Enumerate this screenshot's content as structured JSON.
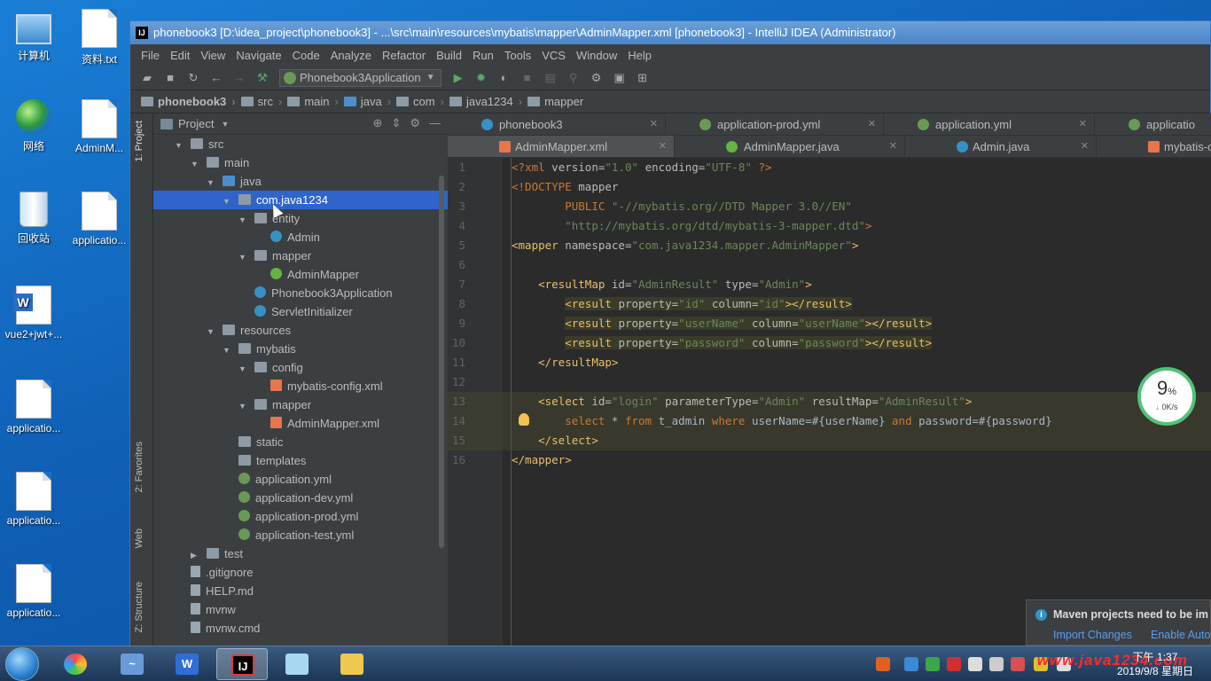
{
  "desktop": {
    "icons": [
      {
        "label": "计算机"
      },
      {
        "label": "资料.txt"
      },
      {
        "label": "网络"
      },
      {
        "label": "AdminM..."
      },
      {
        "label": "回收站"
      },
      {
        "label": "applicatio..."
      },
      {
        "label": "vue2+jwt+..."
      },
      {
        "label": "applicatio..."
      },
      {
        "label": "applicatio..."
      },
      {
        "label": "applicatio..."
      }
    ]
  },
  "window": {
    "title": "phonebook3 [D:\\idea_project\\phonebook3] - ...\\src\\main\\resources\\mybatis\\mapper\\AdminMapper.xml [phonebook3] - IntelliJ IDEA (Administrator)",
    "logo": "IJ"
  },
  "menu": [
    "File",
    "Edit",
    "View",
    "Navigate",
    "Code",
    "Analyze",
    "Refactor",
    "Build",
    "Run",
    "Tools",
    "VCS",
    "Window",
    "Help"
  ],
  "toolbar": {
    "run_config": "Phonebook3Application"
  },
  "breadcrumb": [
    "phonebook3",
    "src",
    "main",
    "java",
    "com",
    "java1234",
    "mapper"
  ],
  "sidebar": {
    "project_label": "1: Project",
    "favorites_label": "2: Favorites",
    "web_label": "Web",
    "structure_label": "Z: Structure"
  },
  "project_panel": {
    "title": "Project",
    "tree": [
      {
        "label": "src",
        "depth": 1,
        "caret": "▼",
        "icon": "folder"
      },
      {
        "label": "main",
        "depth": 2,
        "caret": "▼",
        "icon": "folder"
      },
      {
        "label": "java",
        "depth": 3,
        "caret": "▼",
        "icon": "folder-blue"
      },
      {
        "label": "com.java1234",
        "depth": 4,
        "caret": "▼",
        "icon": "folder",
        "selected": true
      },
      {
        "label": "entity",
        "depth": 5,
        "caret": "▼",
        "icon": "folder"
      },
      {
        "label": "Admin",
        "depth": 6,
        "caret": "",
        "icon": "class"
      },
      {
        "label": "mapper",
        "depth": 5,
        "caret": "▼",
        "icon": "folder"
      },
      {
        "label": "AdminMapper",
        "depth": 6,
        "caret": "",
        "icon": "iface"
      },
      {
        "label": "Phonebook3Application",
        "depth": 5,
        "caret": "",
        "icon": "class"
      },
      {
        "label": "ServletInitializer",
        "depth": 5,
        "caret": "",
        "icon": "class"
      },
      {
        "label": "resources",
        "depth": 3,
        "caret": "▼",
        "icon": "folder"
      },
      {
        "label": "mybatis",
        "depth": 4,
        "caret": "▼",
        "icon": "folder"
      },
      {
        "label": "config",
        "depth": 5,
        "caret": "▼",
        "icon": "folder"
      },
      {
        "label": "mybatis-config.xml",
        "depth": 6,
        "caret": "",
        "icon": "xml"
      },
      {
        "label": "mapper",
        "depth": 5,
        "caret": "▼",
        "icon": "folder"
      },
      {
        "label": "AdminMapper.xml",
        "depth": 6,
        "caret": "",
        "icon": "xml"
      },
      {
        "label": "static",
        "depth": 4,
        "caret": "",
        "icon": "folder"
      },
      {
        "label": "templates",
        "depth": 4,
        "caret": "",
        "icon": "folder"
      },
      {
        "label": "application.yml",
        "depth": 4,
        "caret": "",
        "icon": "spring"
      },
      {
        "label": "application-dev.yml",
        "depth": 4,
        "caret": "",
        "icon": "spring"
      },
      {
        "label": "application-prod.yml",
        "depth": 4,
        "caret": "",
        "icon": "spring"
      },
      {
        "label": "application-test.yml",
        "depth": 4,
        "caret": "",
        "icon": "spring"
      },
      {
        "label": "test",
        "depth": 2,
        "caret": "▶",
        "icon": "folder"
      },
      {
        "label": ".gitignore",
        "depth": 1,
        "caret": "",
        "icon": "file"
      },
      {
        "label": "HELP.md",
        "depth": 1,
        "caret": "",
        "icon": "file"
      },
      {
        "label": "mvnw",
        "depth": 1,
        "caret": "",
        "icon": "file"
      },
      {
        "label": "mvnw.cmd",
        "depth": 1,
        "caret": "",
        "icon": "file"
      }
    ]
  },
  "editor": {
    "tabs_row1": [
      {
        "label": "phonebook3",
        "icon_color": "#3592c4"
      },
      {
        "label": "application-prod.yml",
        "icon_color": "#6a9955"
      },
      {
        "label": "application.yml",
        "icon_color": "#6a9955"
      },
      {
        "label": "applicatio",
        "icon_color": "#6a9955"
      }
    ],
    "tabs_row2": [
      {
        "label": "AdminMapper.xml",
        "icon_color": "#e8764a",
        "active": true
      },
      {
        "label": "AdminMapper.java",
        "icon_color": "#62b543"
      },
      {
        "label": "Admin.java",
        "icon_color": "#3592c4"
      },
      {
        "label": "mybatis-c",
        "icon_color": "#e8764a"
      }
    ],
    "lines": [
      "1",
      "2",
      "3",
      "4",
      "5",
      "6",
      "7",
      "8",
      "9",
      "10",
      "11",
      "12",
      "13",
      "14",
      "15",
      "16"
    ]
  },
  "net_widget": {
    "percent": "9",
    "percent_unit": "%",
    "speed": "0K/s"
  },
  "maven": {
    "message": "Maven projects need to be im",
    "import": "Import Changes",
    "enable": "Enable Auto"
  },
  "taskbar": {
    "clock_time": "下午 1:37",
    "clock_date": "2019/9/8 星期日",
    "watermark": "www.java1234.com"
  }
}
